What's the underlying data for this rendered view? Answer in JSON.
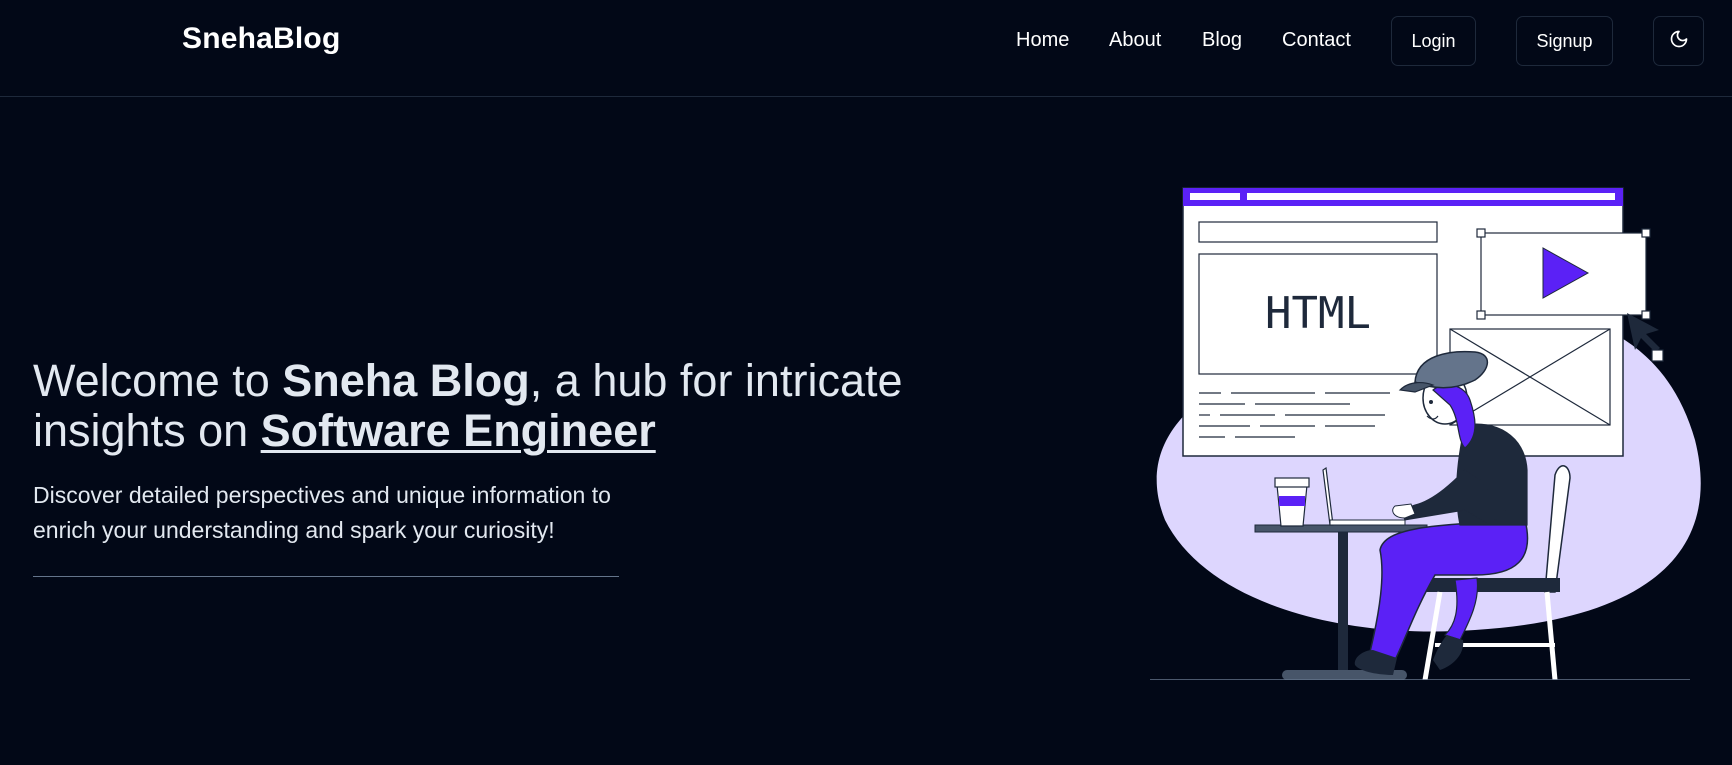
{
  "brand": {
    "name": "SnehaBlog"
  },
  "nav": {
    "links": [
      "Home",
      "About",
      "Blog",
      "Contact"
    ],
    "login_label": "Login",
    "signup_label": "Signup",
    "theme_icon": "moon-icon"
  },
  "hero": {
    "headline_part1": "Welcome to ",
    "headline_bold": "Sneha Blog",
    "headline_part2": ", a hub for intricate insights on ",
    "headline_topic": "Software Engineer",
    "subtext": "Discover detailed perspectives and unique information to enrich your understanding and spark your curiosity!"
  },
  "illustration": {
    "code_label": "HTML",
    "icon": "person-coding-illustration"
  },
  "colors": {
    "background": "#020817",
    "accent": "#5b21f6",
    "blob": "#ddd6fe",
    "text": "#e2e8f0"
  }
}
